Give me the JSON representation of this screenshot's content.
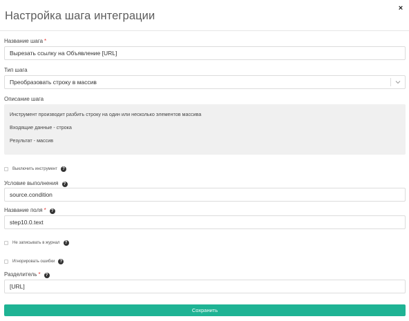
{
  "modal": {
    "title": "Настройка шага интеграции",
    "close_label": "×"
  },
  "fields": {
    "step_name": {
      "label": "Название шага",
      "required_mark": "*",
      "value": "Вырезать ссылку на Объявление [URL]"
    },
    "step_type": {
      "label": "Тип шага",
      "value": "Преобразовать строку в массив"
    },
    "description": {
      "label": "Описание шага",
      "lines": [
        "Инструмент производит разбить строку на один или несколько элементов массива",
        "Входящие данные - строка",
        "Результат - массив"
      ]
    },
    "disable_tool": {
      "label": "Выключить инструмент",
      "checked": false
    },
    "condition": {
      "label": "Условие выполнения",
      "value": "source.condition"
    },
    "field_name": {
      "label": "Название поля",
      "required_mark": "*",
      "value": "step10.0.text"
    },
    "no_log": {
      "label": "Не записывать в журнал",
      "checked": false
    },
    "ignore_errors": {
      "label": "Игнорировать ошибки",
      "checked": false
    },
    "separator": {
      "label": "Разделитель",
      "required_mark": "*",
      "value": "[URL]"
    }
  },
  "actions": {
    "save_label": "Сохранить"
  },
  "colors": {
    "accent": "#1fb394",
    "required": "#e53935"
  },
  "icons": {
    "help": "question-circle-icon",
    "close": "close-icon",
    "dropdown": "chevron-down-icon"
  }
}
